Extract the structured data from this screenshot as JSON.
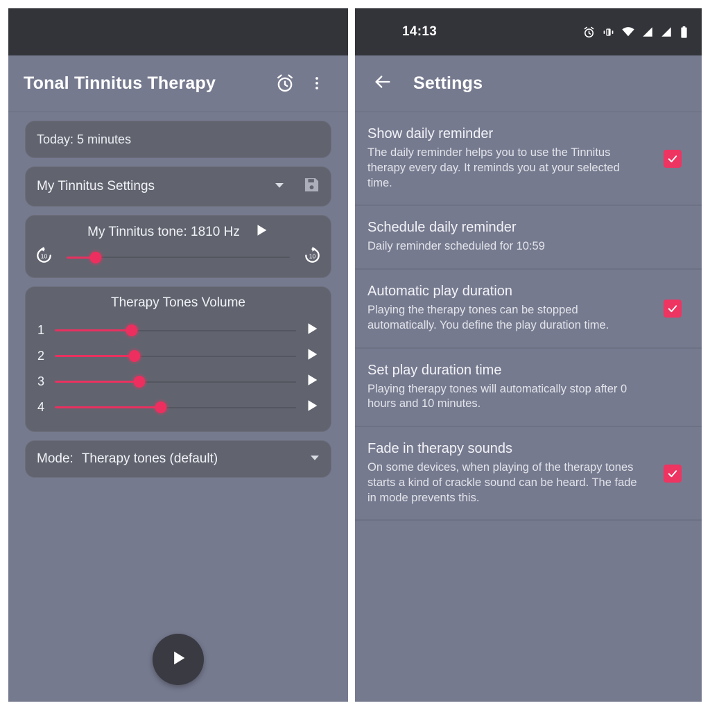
{
  "left": {
    "appbar": {
      "title": "Tonal Tinnitus Therapy",
      "alarm_icon": "alarm-icon",
      "overflow_icon": "more-vertical-icon"
    },
    "today_card": {
      "text": "Today: 5 minutes"
    },
    "preset_card": {
      "name": "My Tinnitus Settings",
      "caret_icon": "chevron-down-icon",
      "save_icon": "save-floppy-icon"
    },
    "tone_card": {
      "label": "My Tinnitus tone: 1810 Hz",
      "play_icon": "play-icon",
      "replay_icon": "replay-10-icon",
      "forward_icon": "forward-10-icon",
      "slider_percent": 13
    },
    "volume_card": {
      "title": "Therapy Tones Volume",
      "rows": [
        {
          "num": "1",
          "percent": 32,
          "play_icon": "play-icon"
        },
        {
          "num": "2",
          "percent": 33,
          "play_icon": "play-icon"
        },
        {
          "num": "3",
          "percent": 35,
          "play_icon": "play-icon"
        },
        {
          "num": "4",
          "percent": 44,
          "play_icon": "play-icon"
        }
      ]
    },
    "mode_card": {
      "label": "Mode:",
      "value": "Therapy tones (default)",
      "caret_icon": "chevron-down-icon"
    },
    "fab": {
      "icon": "play-icon"
    }
  },
  "right": {
    "statusbar": {
      "time": "14:13",
      "icons": [
        "alarm-icon",
        "vibrate-icon",
        "wifi-icon",
        "signal-icon",
        "signal-icon",
        "battery-icon"
      ]
    },
    "appbar": {
      "back_icon": "arrow-back-icon",
      "title": "Settings"
    },
    "items": [
      {
        "title": "Show daily reminder",
        "subtitle": "The daily reminder helps you to use the Tinnitus therapy every day. It reminds you at your selected time.",
        "checked": true
      },
      {
        "title": "Schedule daily reminder",
        "subtitle": "Daily reminder scheduled for 10:59",
        "checked": false
      },
      {
        "title": "Automatic play duration",
        "subtitle": "Playing the therapy tones can be stopped automatically. You define the play duration time.",
        "checked": true
      },
      {
        "title": "Set play duration time",
        "subtitle": "Playing therapy tones will automatically stop after 0 hours and 10 minutes.",
        "checked": false
      },
      {
        "title": "Fade in therapy sounds",
        "subtitle": "On some devices, when playing of the therapy tones starts a kind of crackle sound can be heard. The fade in mode prevents this.",
        "checked": true
      }
    ]
  },
  "colors": {
    "background": "#767a8f",
    "card": "#61646f",
    "statusbar": "#333439",
    "accent": "#ec2f5e",
    "checkbox": "#ee3461",
    "fab": "#3a3a42"
  }
}
